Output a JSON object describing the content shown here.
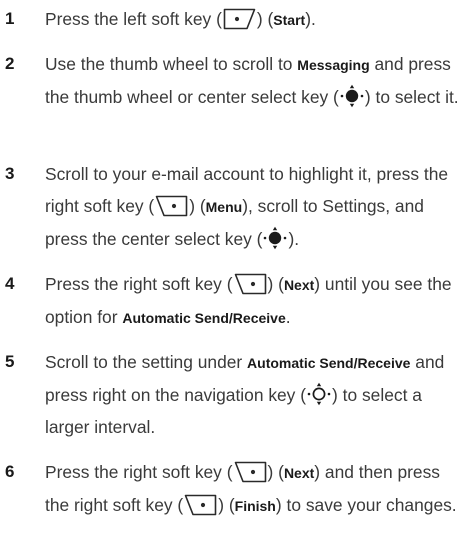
{
  "steps": [
    {
      "num": "1",
      "parts": {
        "a": "Press the left soft key (",
        "b": ") (",
        "c": "Start",
        "d": ")."
      }
    },
    {
      "num": "2",
      "parts": {
        "a": "Use the thumb wheel to scroll to ",
        "b": "Messaging",
        "c": " and press the thumb wheel or center select key (",
        "d": ") to select it."
      }
    },
    {
      "num": "3",
      "parts": {
        "a": "Scroll to your e-mail account to highlight it, press the right soft key (",
        "b": ") (",
        "c": "Menu",
        "d": "), scroll to Settings, and press the center select key (",
        "e": ")."
      }
    },
    {
      "num": "4",
      "parts": {
        "a": "Press the right soft key (",
        "b": ") (",
        "c": "Next",
        "d": ") until you see the option for ",
        "e": "Automatic Send/Receive",
        "f": "."
      }
    },
    {
      "num": "5",
      "parts": {
        "a": "Scroll to the setting under ",
        "b": "Automatic Send/Receive",
        "c": " and press right on the navigation key (",
        "d": ") to select a larger interval."
      }
    },
    {
      "num": "6",
      "parts": {
        "a": "Press the right soft key (",
        "b": ") (",
        "c": "Next",
        "d": ") and then press the right soft key (",
        "e": ") (",
        "f": "Finish",
        "g": ") to save your changes."
      }
    }
  ],
  "icons": {
    "left_soft_key": "left-soft-key-icon",
    "right_soft_key": "right-soft-key-icon",
    "center_select_key": "center-select-key-icon",
    "navigation_key_right": "navigation-key-right-icon"
  }
}
